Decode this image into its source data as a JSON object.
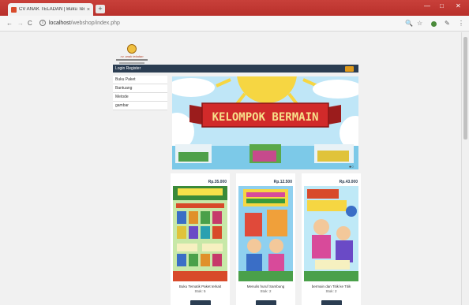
{
  "browser": {
    "tab_title": "CV ANAK TELADAN | Buku Tema",
    "tab_close": "×",
    "new_tab": "+",
    "controls": [
      "—",
      "□",
      "✕"
    ],
    "url_host": "localhost",
    "url_path": "/webshop/index.php",
    "back": "←",
    "forward": "→",
    "reload": "C",
    "info": "i",
    "zoom": "🔍",
    "star": "☆",
    "ext2": "✎",
    "menu": "⋮"
  },
  "site": {
    "logo_text": "cv. anak teladan",
    "topnav": "Login  Register",
    "sidebar": [
      "Buku Paket",
      "Bantuang",
      "Metode",
      "gambar"
    ],
    "banner": "KELOMPOK BERMAIN",
    "slider_dots": "●○"
  },
  "products": [
    {
      "price": "Rp.35.000",
      "name": "Buku Tematik Paket terkait",
      "stock": "Stok: 5"
    },
    {
      "price": "Rp.12.500",
      "name": "Menulis huruf Sambung",
      "stock": "Stok: 2"
    },
    {
      "price": "Rp.43.000",
      "name": "bermain dan Titik ke Titik",
      "stock": "Stok: 2"
    }
  ],
  "colors": {
    "navbar": "#2b3d52",
    "cart_button": "#e09a1a",
    "chrome_titlebar": "#c03832"
  }
}
